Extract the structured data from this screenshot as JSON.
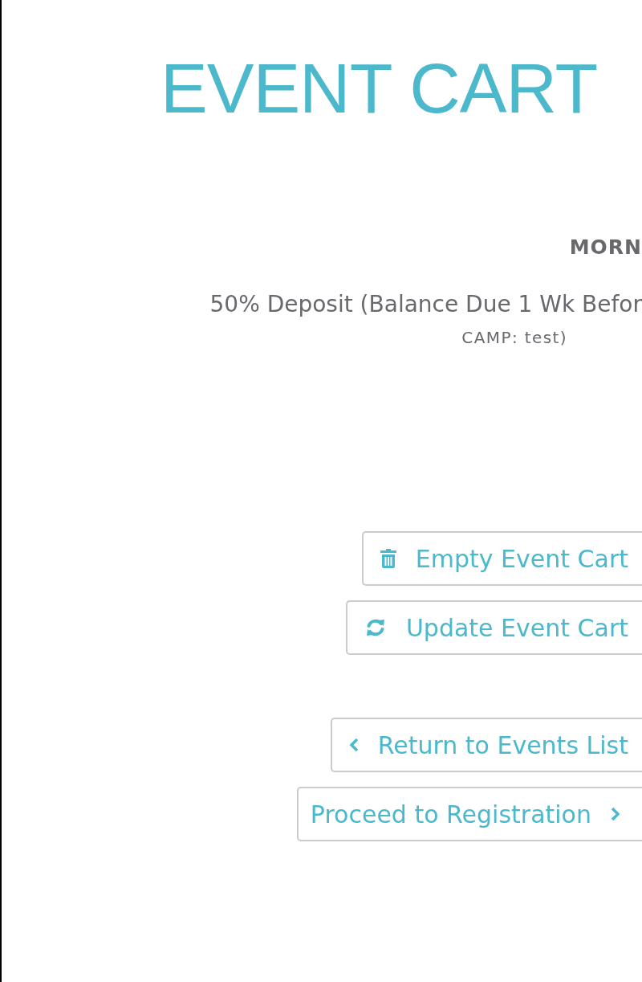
{
  "page_title": "EVENT CART",
  "cart_item": {
    "title": "MORN",
    "description": "50% Deposit (Balance Due 1 Wk Befor",
    "description_continued": "CAMP: test)"
  },
  "cart_actions": [
    {
      "kind": "empty",
      "label": "Empty Event Cart"
    },
    {
      "kind": "update",
      "label": "Update Event Cart"
    }
  ],
  "navigation": [
    {
      "kind": "back",
      "label": "Return to Events List"
    },
    {
      "kind": "forward",
      "label": "Proceed to Registration"
    }
  ]
}
